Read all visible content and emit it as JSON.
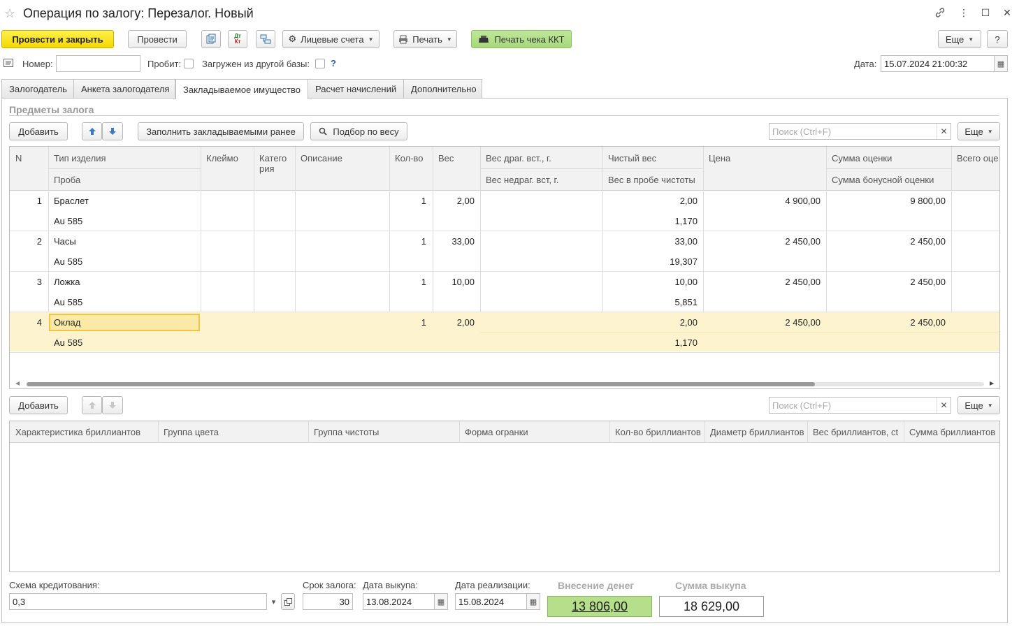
{
  "window": {
    "title": "Операция по залогу: Перезалог. Новый"
  },
  "toolbar": {
    "post_close": "Провести и закрыть",
    "post": "Провести",
    "dtkt": "Дт Кт",
    "accounts": "Лицевые счета",
    "print": "Печать",
    "print_receipt": "Печать чека ККТ",
    "more": "Еще",
    "help": "?"
  },
  "header": {
    "number_label": "Номер:",
    "number_value": "",
    "probit_label": "Пробит:",
    "loaded_label": "Загружен из другой базы:",
    "loaded_help": "?",
    "date_label": "Дата:",
    "date_value": "15.07.2024 21:00:32"
  },
  "tabs": [
    {
      "label": "Залогодатель"
    },
    {
      "label": "Анкета залогодателя"
    },
    {
      "label": "Закладываемое имущество"
    },
    {
      "label": "Расчет начислений"
    },
    {
      "label": "Дополнительно"
    }
  ],
  "items_section": {
    "title": "Предметы залога",
    "add": "Добавить",
    "fill": "Заполнить закладываемыми ранее",
    "weight_pick": "Подбор по весу",
    "search_placeholder": "Поиск (Ctrl+F)",
    "more": "Еще",
    "columns": {
      "n": "N",
      "type": "Тип изделия",
      "probe": "Проба",
      "mark": "Клеймо",
      "category": "Катего\nрия",
      "description": "Описание",
      "qty": "Кол-во",
      "weight": "Вес",
      "stone_w": "Вес драг. вст., г.",
      "nonprec_w": "Вес недраг. вст, г.",
      "net_w": "Чистый вес",
      "pure_w": "Вес в пробе чистоты",
      "price": "Цена",
      "appraisal": "Сумма оценки",
      "bonus": "Сумма бонусной оценки",
      "total": "Всего оце"
    },
    "rows": [
      {
        "n": "1",
        "type": "Браслет",
        "probe": "Au 585",
        "qty": "1",
        "weight": "2,00",
        "net": "2,00",
        "pure": "1,170",
        "price": "4 900,00",
        "sum": "9 800,00"
      },
      {
        "n": "2",
        "type": "Часы",
        "probe": "Au 585",
        "qty": "1",
        "weight": "33,00",
        "net": "33,00",
        "pure": "19,307",
        "price": "2 450,00",
        "sum": "2 450,00"
      },
      {
        "n": "3",
        "type": "Ложка",
        "probe": "Au 585",
        "qty": "1",
        "weight": "10,00",
        "net": "10,00",
        "pure": "5,851",
        "price": "2 450,00",
        "sum": "2 450,00"
      },
      {
        "n": "4",
        "type": "Оклад",
        "probe": "Au 585",
        "qty": "1",
        "weight": "2,00",
        "net": "2,00",
        "pure": "1,170",
        "price": "2 450,00",
        "sum": "2 450,00"
      }
    ]
  },
  "diamonds_section": {
    "add": "Добавить",
    "search_placeholder": "Поиск (Ctrl+F)",
    "more": "Еще",
    "columns": [
      "Характеристика бриллиантов",
      "Группа цвета",
      "Группа чистоты",
      "Форма огранки",
      "Кол-во бриллиантов",
      "Диаметр бриллиантов",
      "Вес бриллиантов, ct",
      "Сумма бриллиантов"
    ]
  },
  "footer": {
    "scheme_label": "Схема кредитования:",
    "scheme_value": "0,3",
    "term_label": "Срок залога:",
    "term_value": "30",
    "buyout_label": "Дата выкупа:",
    "buyout_value": "13.08.2024",
    "sale_label": "Дата реализации:",
    "sale_value": "15.08.2024",
    "deposit_title": "Внесение денег",
    "deposit_value": "13 806,00",
    "buyout_sum_title": "Сумма выкупа",
    "buyout_sum_value": "18 629,00"
  },
  "colors": {
    "primary_button": "#f4d900",
    "receipt_button": "#a7d87b",
    "selected_row": "#fdf3cf",
    "deposit_bg": "#b6df8c"
  }
}
